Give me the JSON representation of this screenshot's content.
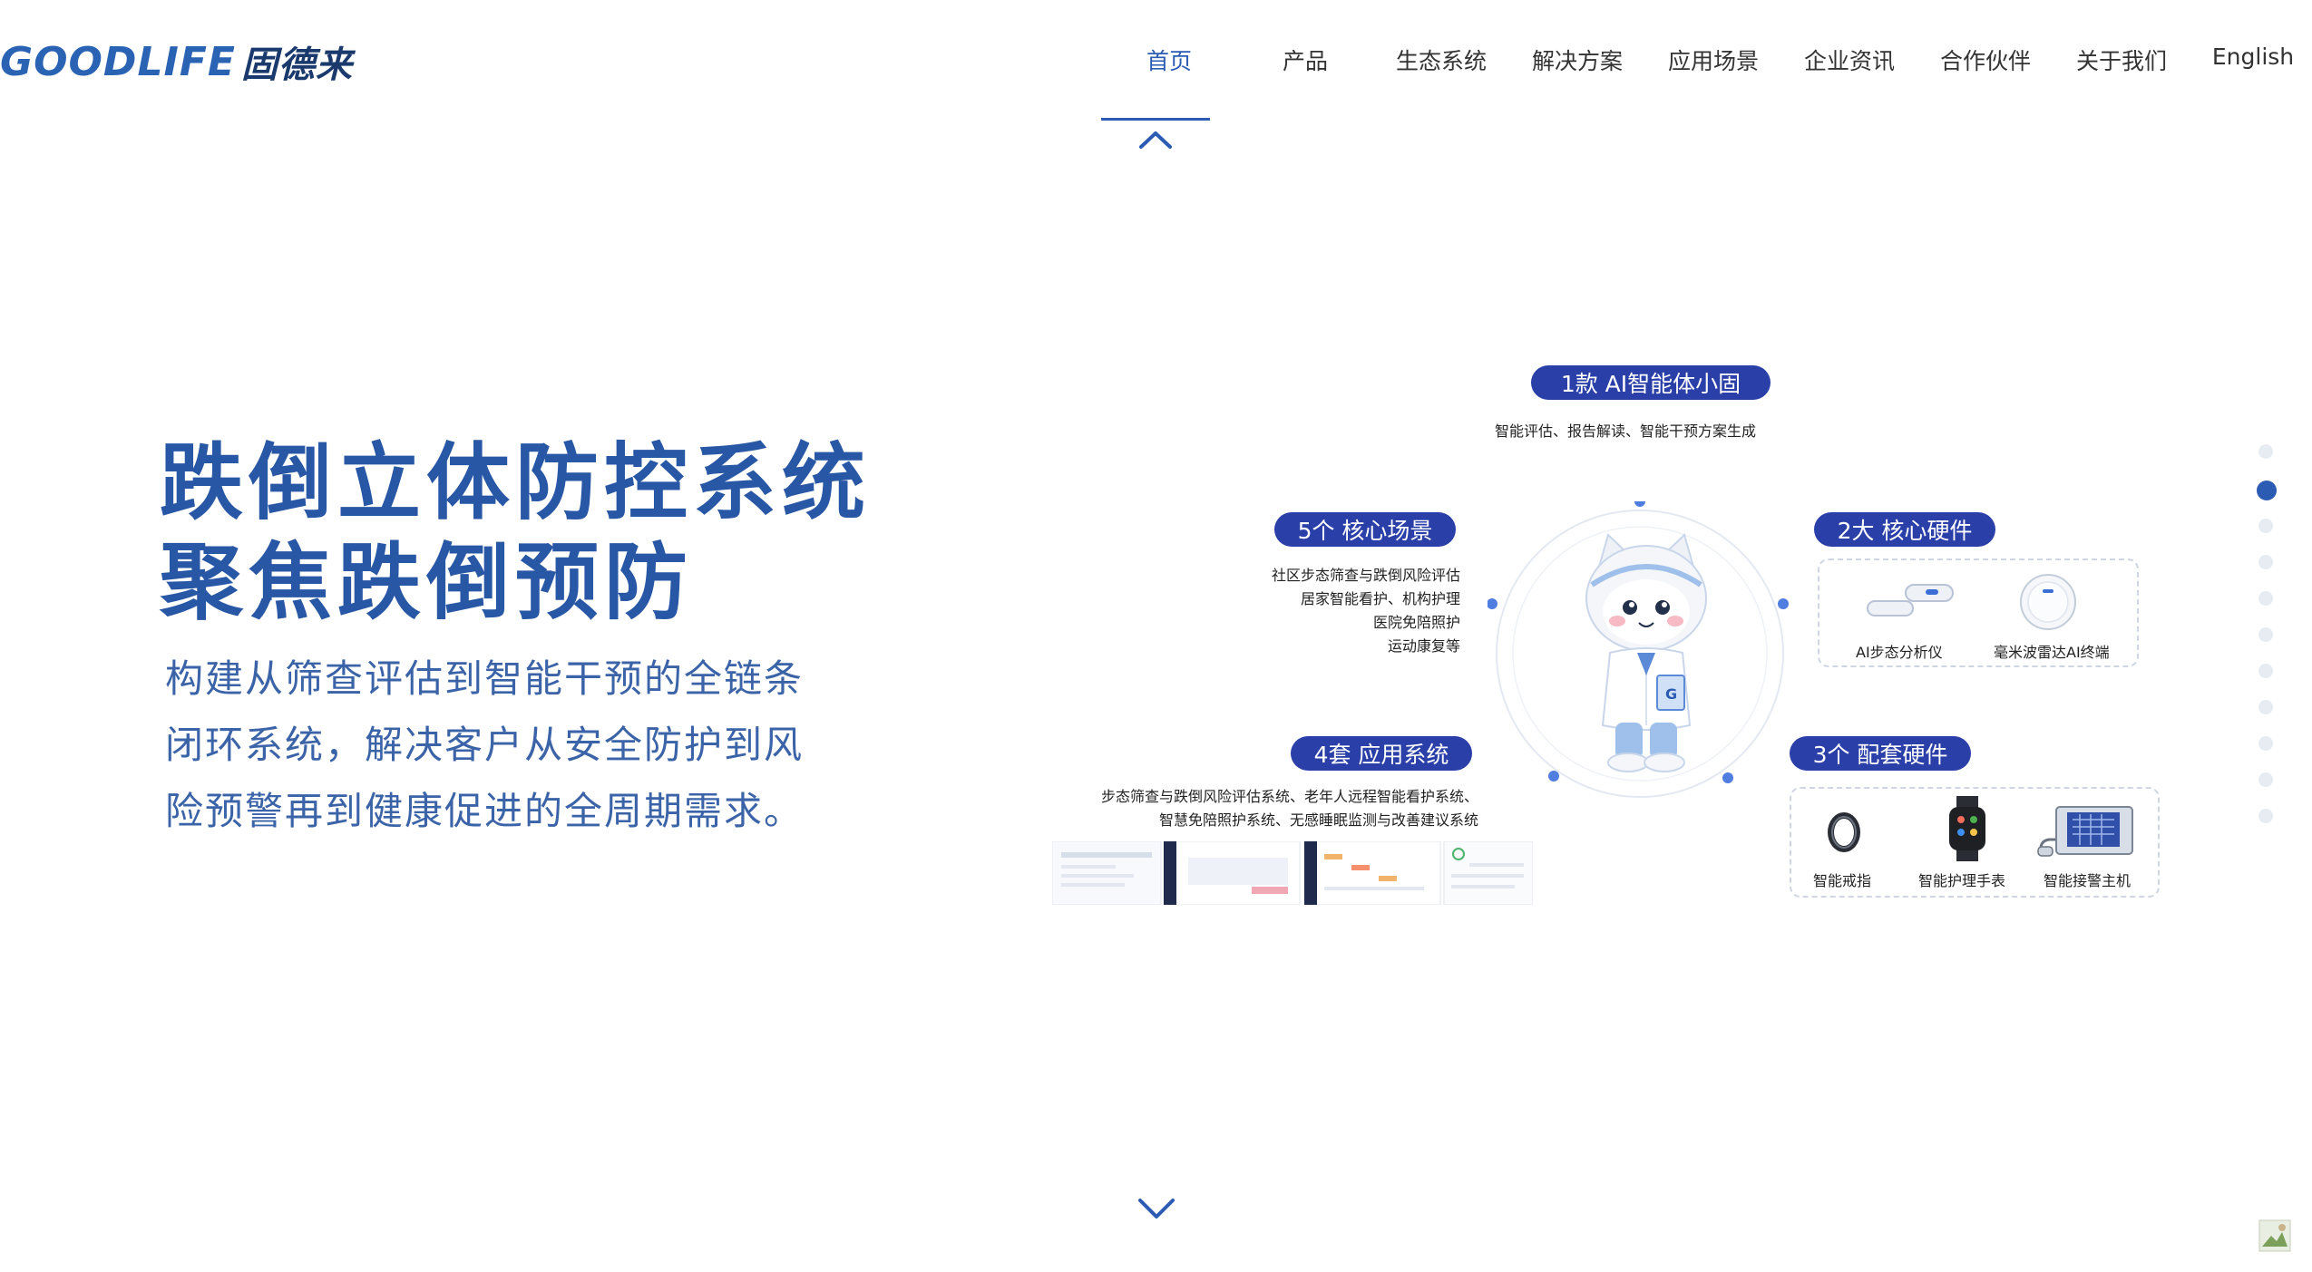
{
  "logo": {
    "en": "GOODLIFE",
    "cn": "固德来"
  },
  "nav": {
    "items": [
      "首页",
      "产品",
      "生态系统",
      "解决方案",
      "应用场景",
      "企业资讯",
      "合作伙伴",
      "关于我们"
    ],
    "english": "English",
    "active_index": 0
  },
  "hero": {
    "title_line1": "跌倒立体防控系统",
    "title_line2": "聚焦跌倒预防",
    "desc_line1": "构建从筛查评估到智能干预的全链条",
    "desc_line2": "闭环系统，解决客户从安全防护到风",
    "desc_line3": "险预警再到健康促进的全周期需求。"
  },
  "diagram": {
    "agent": {
      "label": "1款  AI智能体小固",
      "desc": "智能评估、报告解读、智能干预方案生成"
    },
    "scenes": {
      "label": "5个  核心场景",
      "items": [
        "社区步态筛查与跌倒风险评估",
        "居家智能看护、机构护理",
        "医院免陪照护",
        "运动康复等"
      ]
    },
    "core_hw": {
      "label": "2大  核心硬件",
      "items": [
        "AI步态分析仪",
        "毫米波雷达AI终端"
      ]
    },
    "systems": {
      "label": "4套  应用系统",
      "line1": "步态筛查与跌倒风险评估系统、老年人远程智能看护系统、",
      "line2": "智慧免陪照护系统、无感睡眠监测与改善建议系统"
    },
    "support_hw": {
      "label": "3个  配套硬件",
      "items": [
        "智能戒指",
        "智能护理手表",
        "智能接警主机"
      ]
    }
  },
  "pager": {
    "count": 11,
    "active_index": 1
  },
  "colors": {
    "brand": "#2b5bb3",
    "pill": "#2a3fa8",
    "title": "#2857a5"
  }
}
